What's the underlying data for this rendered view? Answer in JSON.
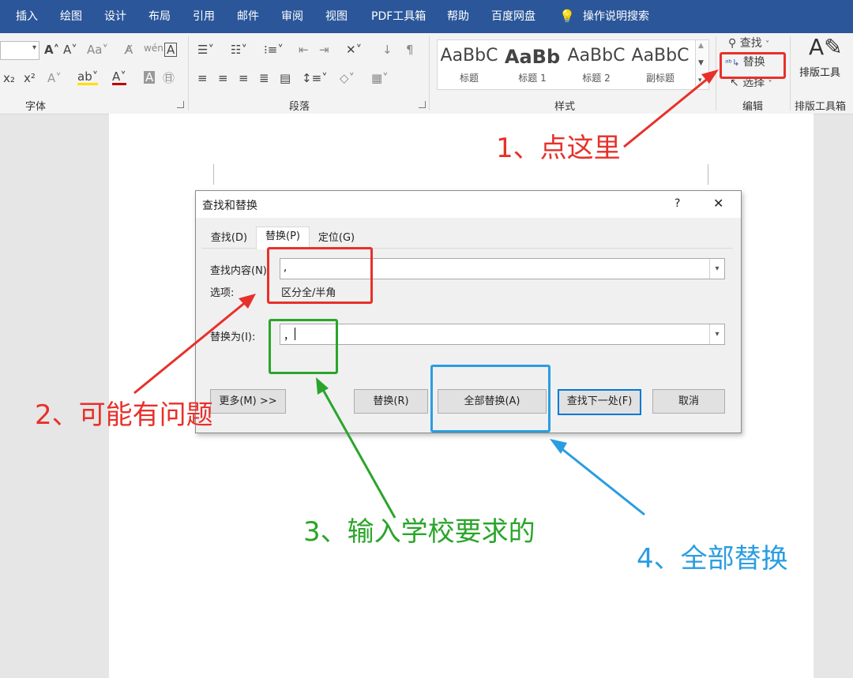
{
  "menubar": {
    "items": [
      "插入",
      "绘图",
      "设计",
      "布局",
      "引用",
      "邮件",
      "审阅",
      "视图",
      "PDF工具箱",
      "帮助",
      "百度网盘"
    ],
    "tell_me": "操作说明搜索"
  },
  "ribbon": {
    "font_group": {
      "label": "字体"
    },
    "paragraph_group": {
      "label": "段落"
    },
    "styles_group": {
      "label": "样式",
      "styles": [
        {
          "sample": "AaBbC",
          "name": "标题"
        },
        {
          "sample": "AaBb",
          "name": "标题 1"
        },
        {
          "sample": "AaBbC",
          "name": "标题 2"
        },
        {
          "sample": "AaBbC",
          "name": "副标题"
        }
      ]
    },
    "editing_group": {
      "label": "编辑",
      "find": "查找",
      "replace": "替换",
      "select": "选择"
    },
    "layout_tools": {
      "button": "排版工具",
      "label": "排版工具箱"
    }
  },
  "dialog": {
    "title": "查找和替换",
    "help": "?",
    "close": "✕",
    "tabs": [
      "查找(D)",
      "替换(P)",
      "定位(G)"
    ],
    "find_label": "查找内容(N):",
    "find_value": ",",
    "options_label": "选项:",
    "options_value": "区分全/半角",
    "replace_label": "替换为(I):",
    "replace_value": "，",
    "buttons": {
      "more": "更多(M) >>",
      "replace": "替换(R)",
      "replace_all": "全部替换(A)",
      "find_next": "查找下一处(F)",
      "cancel": "取消"
    }
  },
  "annotations": {
    "step1": "1、点这里",
    "step2": "2、可能有问题",
    "step3": "3、输入学校要求的",
    "step4": "4、全部替换",
    "colors": {
      "red": "#e8302a",
      "green": "#2aa52a",
      "blue": "#2a9de0"
    }
  }
}
